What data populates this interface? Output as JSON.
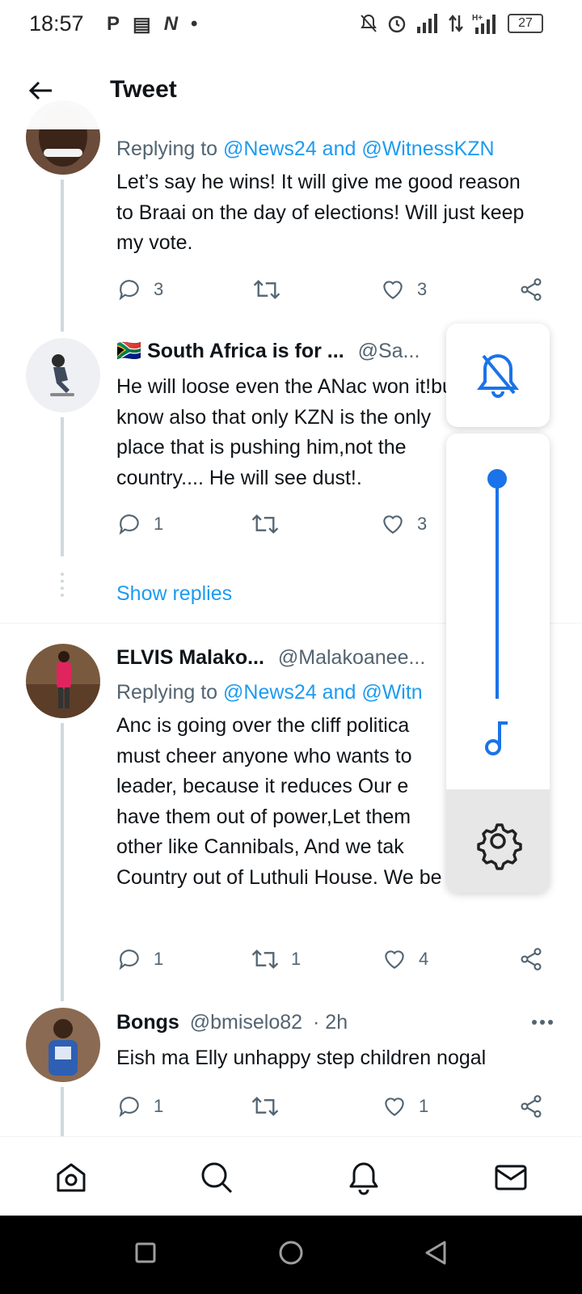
{
  "status_bar": {
    "time": "18:57",
    "left_icons": [
      "parking-icon",
      "news-icon",
      "n-icon",
      "dot-icon"
    ],
    "battery": "27"
  },
  "header": {
    "title": "Tweet"
  },
  "tweets": [
    {
      "replying_prefix": "Replying to ",
      "replying_to": "@News24 and @WitnessKZN",
      "text": "Let’s say he wins! It will give me good reason to Braai on the day of elections! Will just keep my vote.",
      "replies": "3",
      "retweets": "",
      "likes": "3"
    },
    {
      "flag": "🇿🇦",
      "name": "South Africa is for ...",
      "handle": "@Sa...",
      "text": "He will loose even the ANac won it!but know also that only KZN is the only place that is pushing him,not the country.... He will see dust!.",
      "replies": "1",
      "retweets": "",
      "likes": "3",
      "show_replies": "Show replies"
    },
    {
      "name": "ELVIS Malako...",
      "handle": "@Malakoanee...",
      "replying_prefix": "Replying to ",
      "replying_to": "@News24 and @Witn",
      "text": "Anc is going over the cliff politica must cheer anyone who wants to leader, because it reduces Our e have them out of power,Let them other like Cannibals, And we tak Country out of Luthuli House. We be Anc's Stepchildren forever.",
      "replies": "1",
      "retweets": "1",
      "likes": "4"
    },
    {
      "name": "Bongs",
      "handle": "@bmiselo82",
      "time": "· 2h",
      "text": "Eish ma Elly unhappy step children nogal",
      "replies": "1",
      "retweets": "",
      "likes": "1"
    }
  ],
  "volume_panel": {
    "level": 1.0,
    "accent": "#1a73e8"
  },
  "colors": {
    "link": "#1d9bf0",
    "secondary": "#536471"
  }
}
